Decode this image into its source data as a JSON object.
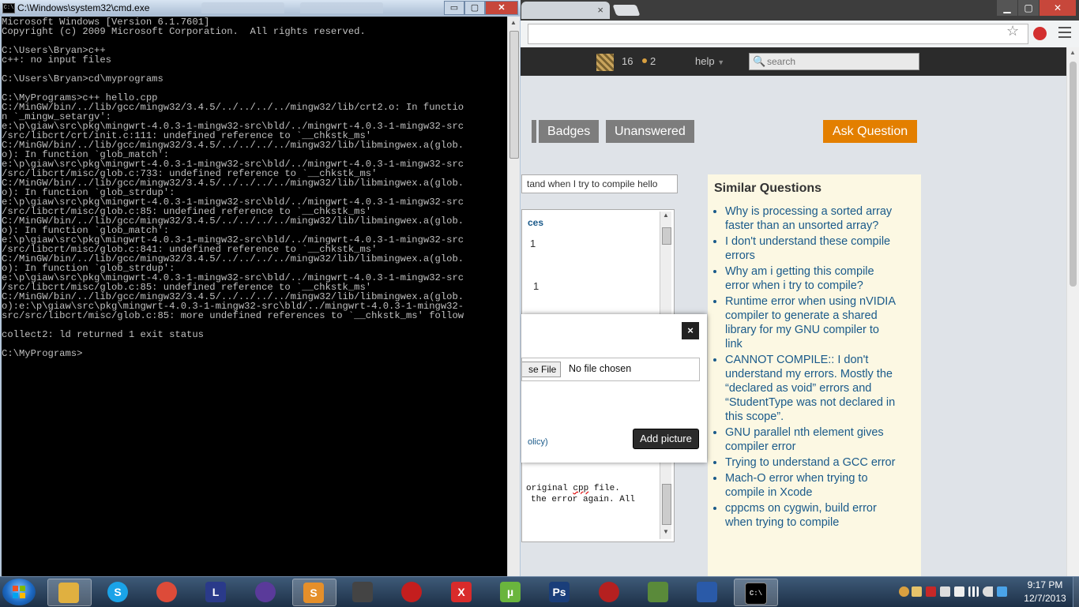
{
  "cmd": {
    "title": "C:\\Windows\\system32\\cmd.exe",
    "icon_label": "C:\\",
    "min_label": "▭",
    "max_label": "▢",
    "close_label": "✕",
    "output": "Microsoft Windows [Version 6.1.7601]\nCopyright (c) 2009 Microsoft Corporation.  All rights reserved.\n\nC:\\Users\\Bryan>c++\nc++: no input files\n\nC:\\Users\\Bryan>cd\\myprograms\n\nC:\\MyPrograms>c++ hello.cpp\nC:/MinGW/bin/../lib/gcc/mingw32/3.4.5/../../../../mingw32/lib/crt2.o: In functio\nn `_mingw_setargv':\ne:\\p\\giaw\\src\\pkg\\mingwrt-4.0.3-1-mingw32-src\\bld/../mingwrt-4.0.3-1-mingw32-src\n/src/libcrt/crt/init.c:111: undefined reference to `__chkstk_ms'\nC:/MinGW/bin/../lib/gcc/mingw32/3.4.5/../../../../mingw32/lib/libmingwex.a(glob.\no): In function `glob_match':\ne:\\p\\giaw\\src\\pkg\\mingwrt-4.0.3-1-mingw32-src\\bld/../mingwrt-4.0.3-1-mingw32-src\n/src/libcrt/misc/glob.c:733: undefined reference to `__chkstk_ms'\nC:/MinGW/bin/../lib/gcc/mingw32/3.4.5/../../../../mingw32/lib/libmingwex.a(glob.\no): In function `glob_strdup':\ne:\\p\\giaw\\src\\pkg\\mingwrt-4.0.3-1-mingw32-src\\bld/../mingwrt-4.0.3-1-mingw32-src\n/src/libcrt/misc/glob.c:85: undefined reference to `__chkstk_ms'\nC:/MinGW/bin/../lib/gcc/mingw32/3.4.5/../../../../mingw32/lib/libmingwex.a(glob.\no): In function `glob_match':\ne:\\p\\giaw\\src\\pkg\\mingwrt-4.0.3-1-mingw32-src\\bld/../mingwrt-4.0.3-1-mingw32-src\n/src/libcrt/misc/glob.c:841: undefined reference to `__chkstk_ms'\nC:/MinGW/bin/../lib/gcc/mingw32/3.4.5/../../../../mingw32/lib/libmingwex.a(glob.\no): In function `glob_strdup':\ne:\\p\\giaw\\src\\pkg\\mingwrt-4.0.3-1-mingw32-src\\bld/../mingwrt-4.0.3-1-mingw32-src\n/src/libcrt/misc/glob.c:85: undefined reference to `__chkstk_ms'\nC:/MinGW/bin/../lib/gcc/mingw32/3.4.5/../../../../mingw32/lib/libmingwex.a(glob.\no):e:\\p\\giaw\\src\\pkg\\mingwrt-4.0.3-1-mingw32-src\\bld/../mingwrt-4.0.3-1-mingw32-\nsrc/src/libcrt/misc/glob.c:85: more undefined references to `__chkstk_ms' follow\n\ncollect2: ld returned 1 exit status\n\nC:\\MyPrograms>"
  },
  "browser": {
    "tab_close": "×",
    "min_label": "▁",
    "max_label": "▢",
    "close_label": "✕",
    "star": "☆",
    "topbar": {
      "reputation": "16",
      "badge_count": "2",
      "help": "help",
      "help_caret": "▼",
      "search_placeholder": "search",
      "search_icon": "🔍"
    },
    "nav": {
      "badges": "Badges",
      "unanswered": "Unanswered",
      "ask": "Ask Question"
    },
    "title_value": "tand when I try to compile hello",
    "sidebar_link": "ces",
    "votes": [
      "1",
      "1"
    ],
    "editor_line1_prefix": "original ",
    "editor_line1_word": "cpp",
    "editor_line1_suffix": " file.",
    "editor_line2": "the error again. All",
    "similar": {
      "title": "Similar Questions",
      "items": [
        "Why is processing a sorted array faster than an unsorted array?",
        "I don't understand these compile errors",
        "Why am i getting this compile error when i try to compile?",
        "Runtime error when using nVIDIA compiler to generate a shared library for my GNU compiler to link",
        "CANNOT COMPILE:: I don't understand my errors. Mostly the “declared as void” errors and “StudentType was not declared in this scope”.",
        "GNU parallel nth element gives compiler error",
        "Trying to understand a GCC error",
        "Mach-O error when trying to compile in Xcode",
        "cppcms on cygwin, build error when trying to compile"
      ]
    },
    "modal": {
      "close": "×",
      "choose_file": "se File",
      "no_file": "No file chosen",
      "policy": "olicy)",
      "add_picture": "Add picture"
    }
  },
  "taskbar": {
    "apps": [
      {
        "name": "windows-explorer",
        "icon": "",
        "color": "#e0b040"
      },
      {
        "name": "skype",
        "icon": "S",
        "color": "#1aa3e8"
      },
      {
        "name": "google-chrome",
        "icon": "",
        "color": "#dd4b39"
      },
      {
        "name": "league-of-legends",
        "icon": "L",
        "color": "#2a3a8a"
      },
      {
        "name": "eclipse",
        "icon": "",
        "color": "#5a3a9a"
      },
      {
        "name": "sublime-text",
        "icon": "S",
        "color": "#e58f2a"
      },
      {
        "name": "inkscape",
        "icon": "",
        "color": "#444444"
      },
      {
        "name": "target-app",
        "icon": "",
        "color": "#c41e1e"
      },
      {
        "name": "xmind",
        "icon": "X",
        "color": "#d92b2b"
      },
      {
        "name": "utorrent",
        "icon": "µ",
        "color": "#6ab53d"
      },
      {
        "name": "photoshop",
        "icon": "Ps",
        "color": "#1a3e7a"
      },
      {
        "name": "downloader",
        "icon": "",
        "color": "#b52020"
      },
      {
        "name": "minecraft",
        "icon": "",
        "color": "#5a8a3a"
      },
      {
        "name": "word-document",
        "icon": "",
        "color": "#2a5aa8"
      },
      {
        "name": "command-prompt",
        "icon": "C:\\",
        "color": "#000000"
      }
    ],
    "clock_time": "9:17 PM",
    "clock_date": "12/7/2013"
  }
}
